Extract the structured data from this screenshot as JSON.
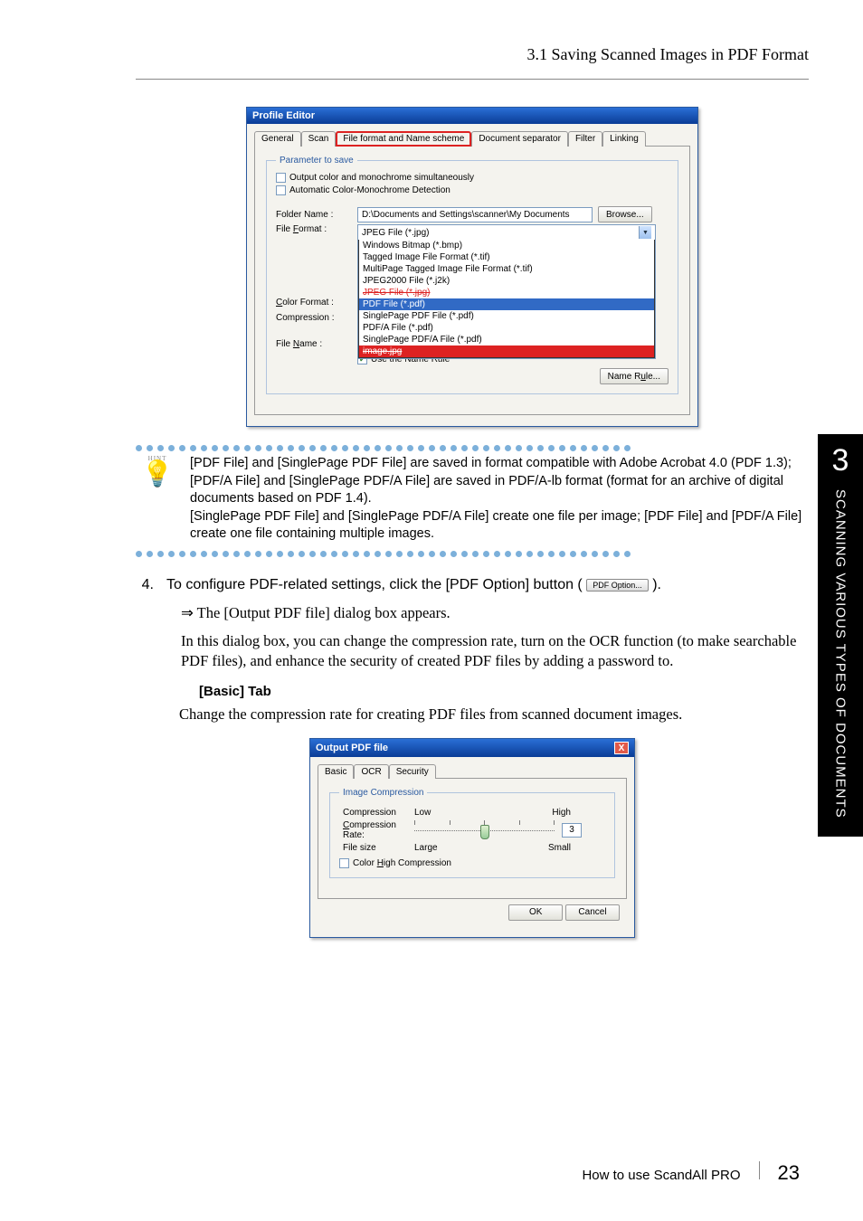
{
  "header": {
    "title": "3.1 Saving Scanned Images in PDF Format"
  },
  "profile_editor": {
    "title": "Profile Editor",
    "tabs": [
      "General",
      "Scan",
      "File format and Name scheme",
      "Document separator",
      "Filter",
      "Linking"
    ],
    "active_tab_index": 2,
    "param_legend": "Parameter to save",
    "chk_output": "Output color and monochrome simultaneously",
    "chk_auto": "Automatic Color-Monochrome Detection",
    "folder_name_label": "Folder Name :",
    "folder_name_value": "D:\\Documents and Settings\\scanner\\My Documents",
    "browse": "Browse...",
    "file_format_label": "File Format :",
    "file_format_selected": "JPEG File (*.jpg)",
    "file_format_options": [
      "Windows Bitmap (*.bmp)",
      "Tagged Image File Format (*.tif)",
      "MultiPage Tagged Image File Format (*.tif)",
      "JPEG2000 File (*.j2k)",
      "JPEG File (*.jpg)",
      "PDF File (*.pdf)",
      "SinglePage PDF File (*.pdf)",
      "PDF/A File (*.pdf)",
      "SinglePage PDF/A File (*.pdf)",
      "image.jpg"
    ],
    "color_format_label": "Color Format :",
    "compression_label": "Compression :",
    "file_name_label": "File Name :",
    "use_name_rule": "Use the Name Rule",
    "name_rule_btn": "Name Rule..."
  },
  "hint": {
    "label": "HINT",
    "text1": "[PDF File] and [SinglePage PDF File] are saved in format compatible with Adobe Acrobat 4.0 (PDF 1.3); [PDF/A File] and [SinglePage PDF/A File] are saved in PDF/A-lb format (format for an archive of digital documents based on PDF 1.4).",
    "text2": "[SinglePage PDF File] and [SinglePage PDF/A File] create one file per image; [PDF File] and [PDF/A File] create one file containing multiple images."
  },
  "step4": {
    "num": "4.",
    "text_a": "To configure PDF-related settings, click the [PDF Option] button (",
    "pdf_btn": "PDF Option...",
    "text_b": ").",
    "arrow": "⇒ The [Output PDF file] dialog box appears.",
    "para": "In this dialog box, you can change the compression rate, turn on the OCR function (to make searchable PDF files), and enhance the security of created PDF files by adding a password to.",
    "basic_tab_head": "[Basic] Tab",
    "basic_tab_desc": "Change the compression rate for creating PDF files from scanned document images."
  },
  "output_pdf": {
    "title": "Output PDF file",
    "tabs": [
      "Basic",
      "OCR",
      "Security"
    ],
    "legend": "Image Compression",
    "comp_label": "Compression",
    "low": "Low",
    "high": "High",
    "rate_label": "Compression Rate:",
    "rate_value": "3",
    "size_label": "File size",
    "large": "Large",
    "small": "Small",
    "color_high": "Color High Compression",
    "ok": "OK",
    "cancel": "Cancel"
  },
  "side": {
    "num": "3",
    "text": "SCANNING VARIOUS TYPES OF DOCUMENTS"
  },
  "footer": {
    "label": "How to use ScandAll PRO",
    "page": "23"
  }
}
